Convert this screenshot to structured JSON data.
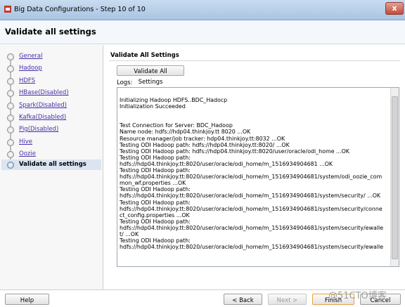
{
  "window": {
    "title": "Big Data Configurations - Step 10 of 10",
    "close_label": "x"
  },
  "header": {
    "title": "Validate all settings"
  },
  "nav": {
    "items": [
      {
        "label": "General"
      },
      {
        "label": "Hadoop"
      },
      {
        "label": "HDFS"
      },
      {
        "label": "HBase(Disabled)"
      },
      {
        "label": "Spark(Disabled)"
      },
      {
        "label": "Kafka(Disabled)"
      },
      {
        "label": "Pig(Disabled)"
      },
      {
        "label": "Hive"
      },
      {
        "label": "Oozie"
      }
    ],
    "current": "Validate all settings"
  },
  "content": {
    "section_title": "Validate All Settings",
    "validate_button": "Validate All Settings",
    "logs_label": "Logs:",
    "log_lines": [
      "Initializing Hadoop HDFS..BDC_Hadocp",
      "Initialization Succeeded",
      "",
      "",
      "Test Connection for Server: BDC_Hadoop",
      "Name node: hdfs://hdp04.thinkjoy.tt 8020 ...OK",
      "Resource manager/job tracker: hdp04.thinkjoy.tt:8032 ...OK",
      "Testing ODI Hadoop path: hdfs://hdp04.thinkjoy.tt:8020/ ...OK",
      "Testing ODI Hadoop path: hdfs://hdp04.thinkjoy.tt:8020/user/oracle/odi_home ...OK",
      "Testing ODI Hadoop path:",
      "hdfs://hdp04.thinkjoy.tt:8020/user/oracle/odi_home/m_1516934904681 ...OK",
      "Testing ODI Hadoop path:",
      "hdfs://hdp04.thinkjoy.tt:8020/user/oracle/odi_home/m_1516934904681/system/odi_oozie_com",
      "mon_wf.properties ...OK",
      "Testing ODI Hadoop path:",
      "hdfs://hdp04.thinkjoy.tt:8020/user/oracle/odi_home/m_1516934904681/system/security/ ...OK",
      "Testing ODI Hadoop path:",
      "hdfs://hdp04.thinkjoy.tt:8020/user/oracle/odi_home/m_1516934904681/system/security/conne",
      "ct_config.properties ...OK",
      "Testing ODI Hadoop path:",
      "hdfs://hdp04.thinkjoy.tt:8020/user/oracle/odi_home/m_1516934904681/system/security/ewalle",
      "t/ ...OK",
      "Testing ODI Hadoop path:",
      "hdfs://hdp04.thinkjoy.tt:8020/user/oracle/odi_home/m_1516934904681/system/security/ewalle"
    ]
  },
  "footer": {
    "help": "Help",
    "back": "< Back",
    "next": "Next >",
    "finish": "Finish",
    "cancel": "Cancel"
  },
  "watermark": "@51CTO博客"
}
